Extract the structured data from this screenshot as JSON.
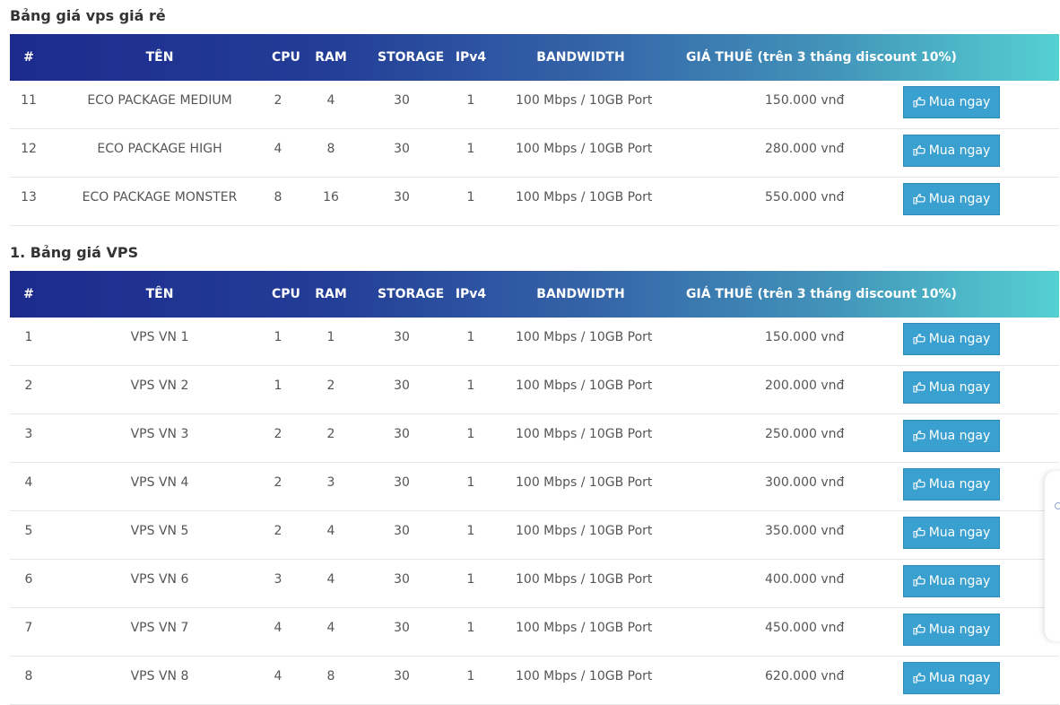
{
  "section1": {
    "title": "Bảng giá vps giá rẻ",
    "headers": [
      "#",
      "TÊN",
      "CPU",
      "RAM",
      "STORAGE",
      "IPv4",
      "BANDWIDTH",
      "GIÁ THUÊ (trên 3 tháng discount 10%)"
    ],
    "rows": [
      {
        "num": "11",
        "name": "ECO PACKAGE MEDIUM",
        "cpu": "2",
        "ram": "4",
        "storage": "30",
        "ipv4": "1",
        "bandwidth": "100 Mbps / 10GB Port",
        "price": "150.000 vnđ",
        "button": "Mua ngay"
      },
      {
        "num": "12",
        "name": "ECO PACKAGE HIGH",
        "cpu": "4",
        "ram": "8",
        "storage": "30",
        "ipv4": "1",
        "bandwidth": "100 Mbps / 10GB Port",
        "price": "280.000 vnđ",
        "button": "Mua ngay"
      },
      {
        "num": "13",
        "name": "ECO PACKAGE MONSTER",
        "cpu": "8",
        "ram": "16",
        "storage": "30",
        "ipv4": "1",
        "bandwidth": "100 Mbps / 10GB Port",
        "price": "550.000 vnđ",
        "button": "Mua ngay"
      }
    ]
  },
  "section2": {
    "title": "1. Bảng giá VPS",
    "headers": [
      "#",
      "TÊN",
      "CPU",
      "RAM",
      "STORAGE",
      "IPv4",
      "BANDWIDTH",
      "GIÁ THUÊ (trên 3 tháng discount 10%)"
    ],
    "rows": [
      {
        "num": "1",
        "name": "VPS VN 1",
        "cpu": "1",
        "ram": "1",
        "storage": "30",
        "ipv4": "1",
        "bandwidth": "100 Mbps / 10GB Port",
        "price": "150.000 vnđ",
        "button": "Mua ngay"
      },
      {
        "num": "2",
        "name": "VPS VN 2",
        "cpu": "1",
        "ram": "2",
        "storage": "30",
        "ipv4": "1",
        "bandwidth": "100 Mbps / 10GB Port",
        "price": "200.000 vnđ",
        "button": "Mua ngay"
      },
      {
        "num": "3",
        "name": "VPS VN 3",
        "cpu": "2",
        "ram": "2",
        "storage": "30",
        "ipv4": "1",
        "bandwidth": "100 Mbps / 10GB Port",
        "price": "250.000 vnđ",
        "button": "Mua ngay"
      },
      {
        "num": "4",
        "name": "VPS VN 4",
        "cpu": "2",
        "ram": "3",
        "storage": "30",
        "ipv4": "1",
        "bandwidth": "100 Mbps / 10GB Port",
        "price": "300.000 vnđ",
        "button": "Mua ngay"
      },
      {
        "num": "5",
        "name": "VPS VN 5",
        "cpu": "2",
        "ram": "4",
        "storage": "30",
        "ipv4": "1",
        "bandwidth": "100 Mbps / 10GB Port",
        "price": "350.000 vnđ",
        "button": "Mua ngay"
      },
      {
        "num": "6",
        "name": "VPS VN 6",
        "cpu": "3",
        "ram": "4",
        "storage": "30",
        "ipv4": "1",
        "bandwidth": "100 Mbps / 10GB Port",
        "price": "400.000 vnđ",
        "button": "Mua ngay"
      },
      {
        "num": "7",
        "name": "VPS VN 7",
        "cpu": "4",
        "ram": "4",
        "storage": "30",
        "ipv4": "1",
        "bandwidth": "100 Mbps / 10GB Port",
        "price": "450.000 vnđ",
        "button": "Mua ngay"
      },
      {
        "num": "8",
        "name": "VPS VN 8",
        "cpu": "4",
        "ram": "8",
        "storage": "30",
        "ipv4": "1",
        "bandwidth": "100 Mbps / 10GB Port",
        "price": "620.000 vnđ",
        "button": "Mua ngay"
      }
    ]
  },
  "theme": {
    "header_gradient_start": "#1c2a8e",
    "header_gradient_end": "#55d0d2",
    "button_color": "#3aa0cf",
    "button_icon": "hand-pointer-icon"
  }
}
